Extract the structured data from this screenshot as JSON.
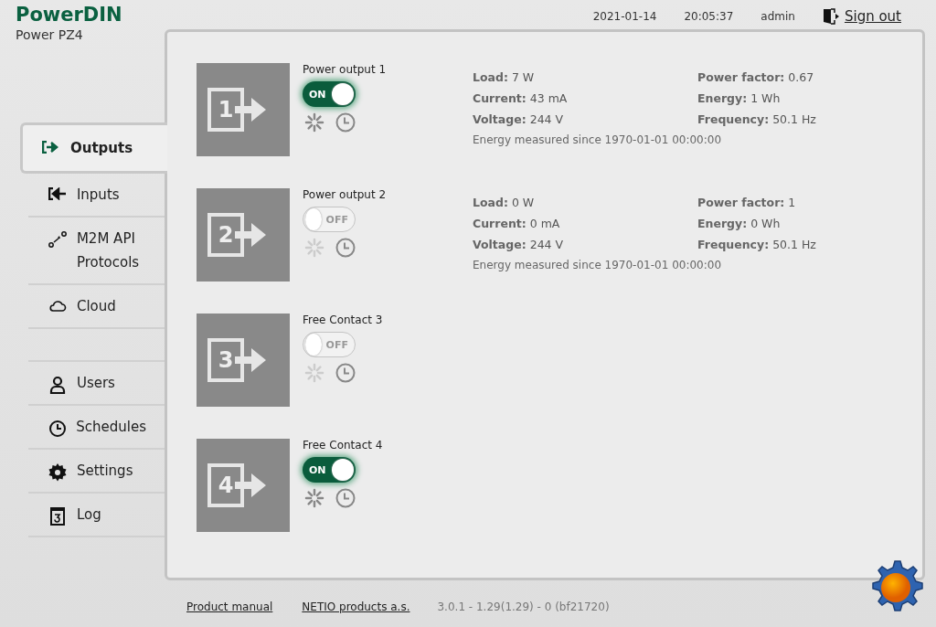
{
  "brand": {
    "title": "PowerDIN",
    "subtitle": "Power PZ4"
  },
  "header": {
    "date": "2021-01-14",
    "time": "20:05:37",
    "user": "admin",
    "signout": "Sign out"
  },
  "sidebar": {
    "items": [
      {
        "kind": "outputs",
        "label": "Outputs",
        "selected": true
      },
      {
        "kind": "inputs",
        "label": "Inputs",
        "selected": false
      },
      {
        "kind": "api",
        "label": "M2M API Protocols",
        "selected": false
      },
      {
        "kind": "cloud",
        "label": "Cloud",
        "selected": false
      },
      {
        "kind": "spacer"
      },
      {
        "kind": "users",
        "label": "Users",
        "selected": false
      },
      {
        "kind": "schedules",
        "label": "Schedules",
        "selected": false
      },
      {
        "kind": "settings",
        "label": "Settings",
        "selected": false
      },
      {
        "kind": "log",
        "label": "Log",
        "selected": false
      }
    ]
  },
  "outputs": [
    {
      "number": "1",
      "name": "Power output 1",
      "on": true,
      "toggle": "ON",
      "measurements": {
        "left": [
          {
            "label": "Load:",
            "value": "7 W"
          },
          {
            "label": "Current:",
            "value": "43 mA"
          },
          {
            "label": "Voltage:",
            "value": "244 V"
          }
        ],
        "right": [
          {
            "label": "Power factor:",
            "value": "0.67"
          },
          {
            "label": "Energy:",
            "value": "1 Wh"
          },
          {
            "label": "Frequency:",
            "value": "50.1 Hz"
          }
        ],
        "note": "Energy measured since 1970-01-01 00:00:00"
      }
    },
    {
      "number": "2",
      "name": "Power output 2",
      "on": false,
      "toggle": "OFF",
      "measurements": {
        "left": [
          {
            "label": "Load:",
            "value": "0 W"
          },
          {
            "label": "Current:",
            "value": "0 mA"
          },
          {
            "label": "Voltage:",
            "value": "244 V"
          }
        ],
        "right": [
          {
            "label": "Power factor:",
            "value": "1"
          },
          {
            "label": "Energy:",
            "value": "0 Wh"
          },
          {
            "label": "Frequency:",
            "value": "50.1 Hz"
          }
        ],
        "note": "Energy measured since 1970-01-01 00:00:00"
      }
    },
    {
      "number": "3",
      "name": "Free Contact 3",
      "on": false,
      "toggle": "OFF"
    },
    {
      "number": "4",
      "name": "Free Contact 4",
      "on": true,
      "toggle": "ON"
    }
  ],
  "footer": {
    "links": [
      "Product manual",
      "NETIO products a.s."
    ],
    "version": "3.0.1 - 1.29(1.29) - 0 (bf21720)"
  }
}
